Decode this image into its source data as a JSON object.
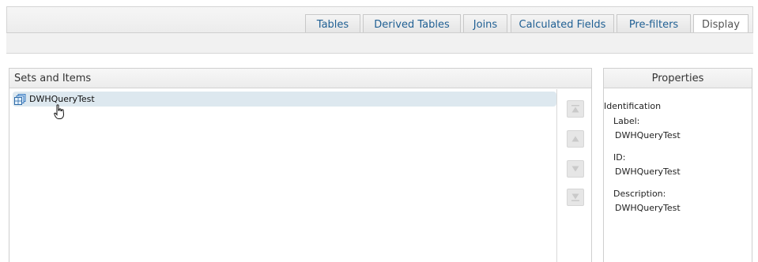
{
  "tabs": [
    {
      "label": "Tables",
      "active": false
    },
    {
      "label": "Derived Tables",
      "active": false
    },
    {
      "label": "Joins",
      "active": false
    },
    {
      "label": "Calculated Fields",
      "active": false
    },
    {
      "label": "Pre-filters",
      "active": false
    },
    {
      "label": "Display",
      "active": true
    }
  ],
  "sets_panel": {
    "title": "Sets and Items",
    "items": [
      {
        "label": "DWHQueryTest",
        "icon": "cube-set-icon",
        "selected": true
      }
    ],
    "move_buttons": [
      "move-top",
      "move-up",
      "move-down",
      "move-bottom"
    ]
  },
  "properties_panel": {
    "title": "Properties",
    "section": "Identification",
    "label_caption": "Label:",
    "label_value": "DWHQueryTest",
    "id_caption": "ID:",
    "id_value": "DWHQueryTest",
    "description_caption": "Description:",
    "description_value": "DWHQueryTest"
  },
  "colors": {
    "tab_text": "#1f5f93",
    "selected_row": "#dde8ef",
    "panel_border": "#cfcfcf"
  }
}
